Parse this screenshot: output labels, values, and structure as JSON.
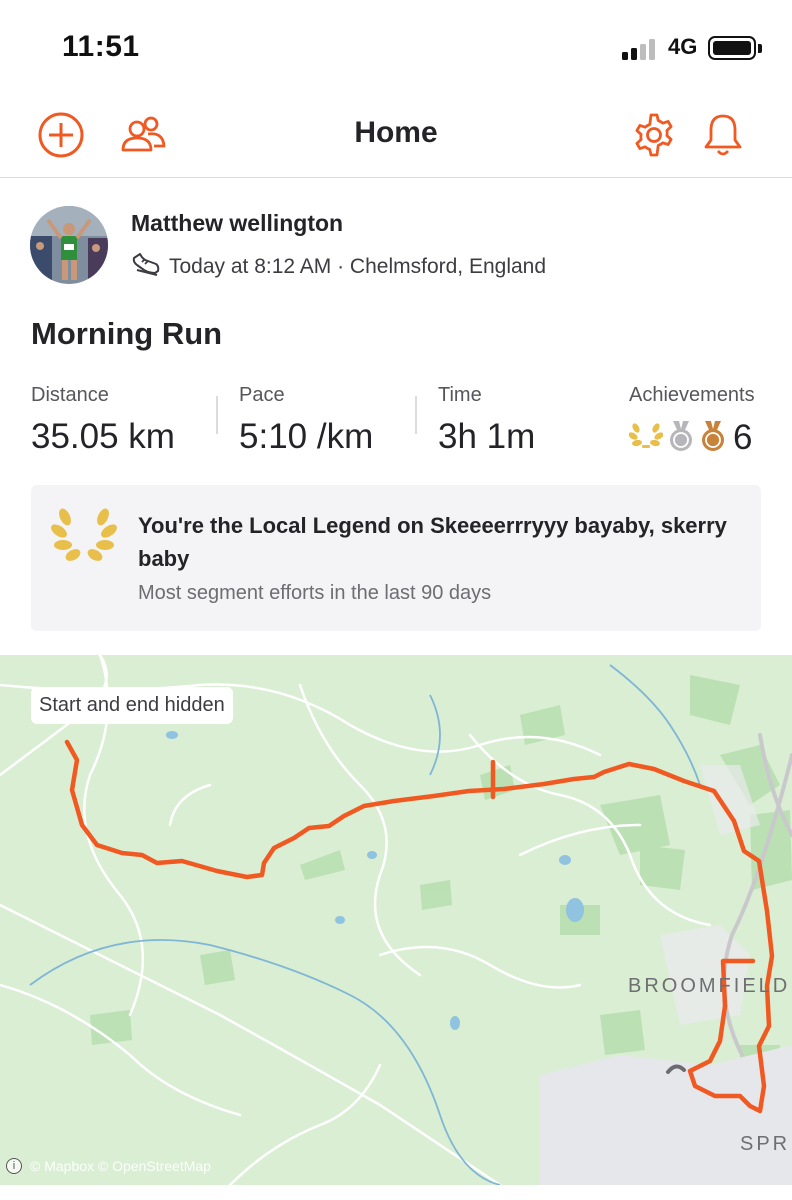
{
  "status_bar": {
    "time": "11:51",
    "network": "4G"
  },
  "nav": {
    "title": "Home"
  },
  "activity": {
    "athlete": "Matthew wellington",
    "meta": "Today at 8:12 AM · Chelmsford, England",
    "title": "Morning Run",
    "stats": [
      {
        "label": "Distance",
        "value": "35.05 km"
      },
      {
        "label": "Pace",
        "value": "5:10 /km"
      },
      {
        "label": "Time",
        "value": "3h 1m"
      }
    ],
    "achievements": {
      "label": "Achievements",
      "count": "6"
    }
  },
  "legend": {
    "title": "You're the Local Legend on Skeeeerrryyy bayaby, skerry baby",
    "subtitle": "Most segment efforts in the last 90 days"
  },
  "map": {
    "chip": "Start and end hidden",
    "place_label_1": "BROOMFIELD",
    "place_label_2": "SPR",
    "attribution": "© Mapbox © OpenStreetMap",
    "route_color": "#f05a22"
  },
  "colors": {
    "accent": "#f05a22",
    "gold": "#e8bf4a",
    "silver": "#b7b7bb",
    "bronze": "#c8823a"
  },
  "icons": {
    "add": "plus-circle-icon",
    "friends": "people-icon",
    "settings": "gear-icon",
    "notifications": "bell-icon",
    "activity_type": "running-shoe-icon",
    "legend": "laurel-icon"
  }
}
